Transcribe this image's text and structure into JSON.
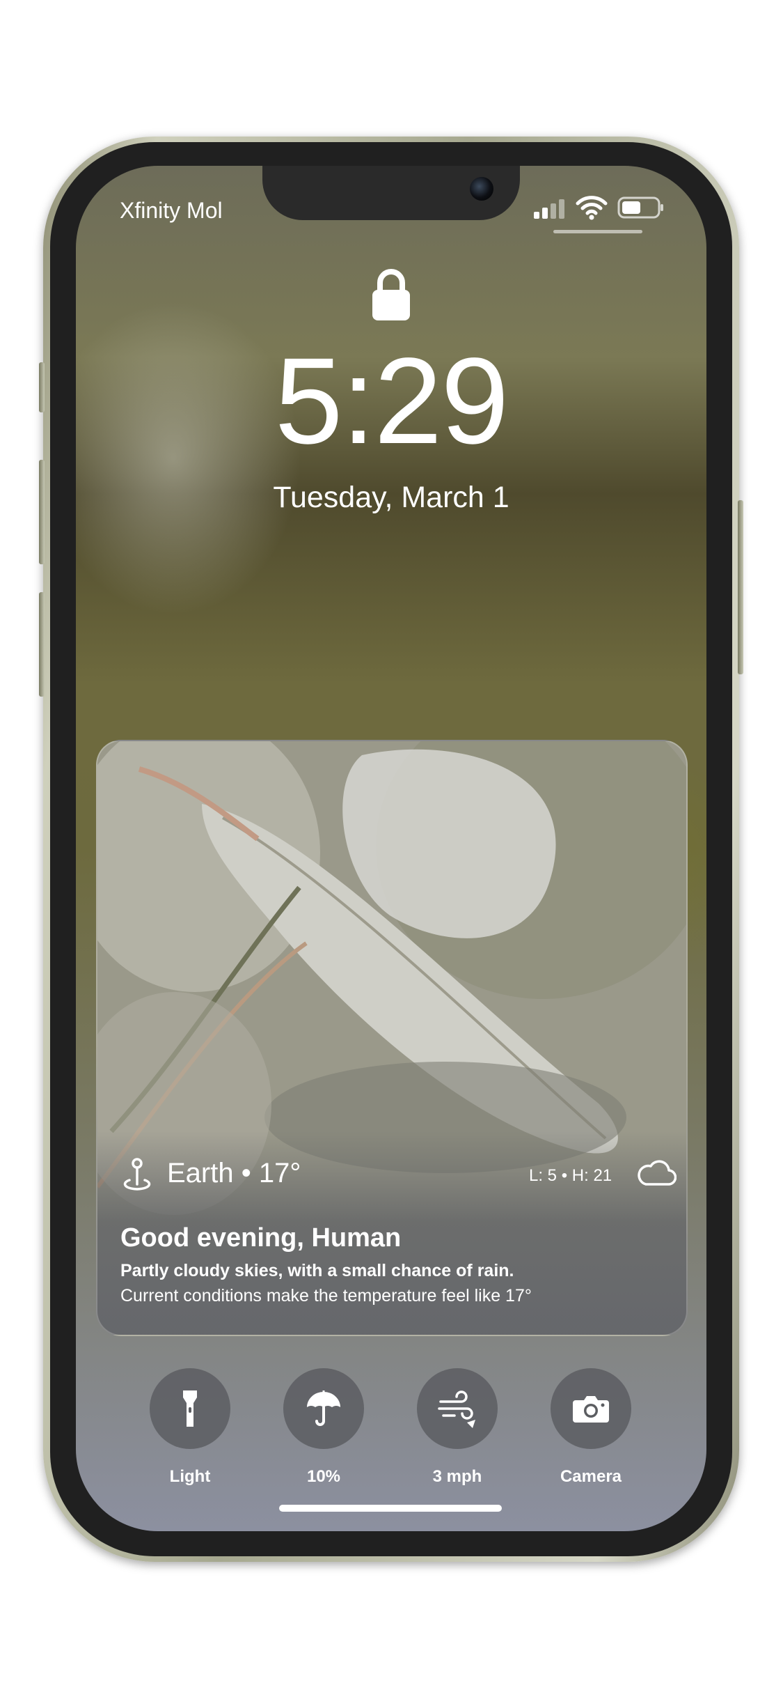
{
  "status_bar": {
    "carrier": "Xfinity Mol",
    "signal_icon": "cellular-signal-icon",
    "wifi_icon": "wifi-icon",
    "battery_icon": "battery-icon"
  },
  "lock_screen": {
    "lock_icon": "lock-icon",
    "time": "5:29",
    "date": "Tuesday, March 1"
  },
  "weather_widget": {
    "location_icon": "map-pin-icon",
    "location": "Earth • 17°",
    "low_high": "L: 5 • H: 21",
    "condition_icon": "cloud-icon",
    "greeting": "Good evening, Human",
    "forecast": "Partly cloudy skies, with a small chance of rain.",
    "conditions": "Current conditions make the temperature feel like 17°"
  },
  "quick_actions": [
    {
      "label": "Light",
      "icon": "flashlight-icon"
    },
    {
      "label": "10%",
      "icon": "umbrella-icon"
    },
    {
      "label": "3 mph",
      "icon": "wind-icon"
    },
    {
      "label": "Camera",
      "icon": "camera-icon"
    }
  ],
  "colors": {
    "phone_frame": "#c7c8b4",
    "bezel": "#202020",
    "widget_bottom": "#6d6e71",
    "text": "#ffffff"
  }
}
